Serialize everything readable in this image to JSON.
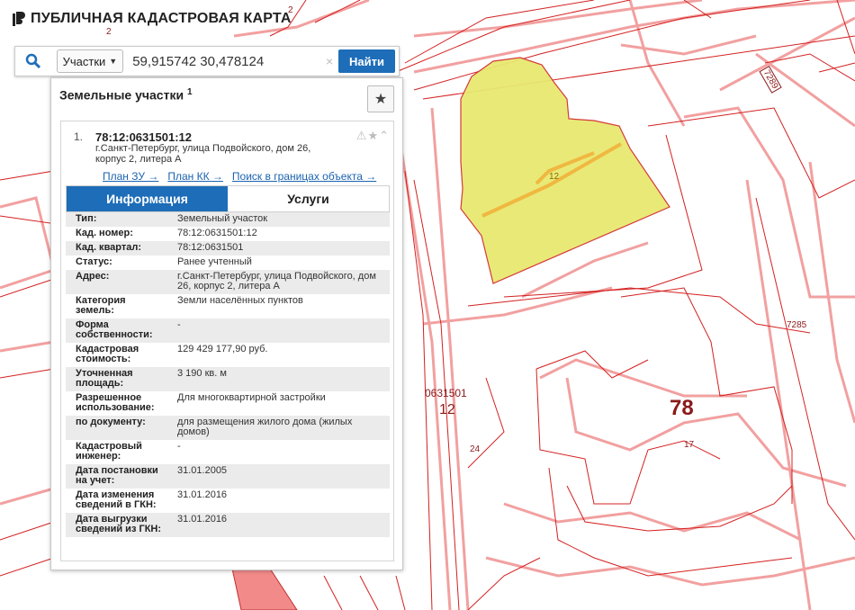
{
  "app": {
    "title": "ПУБЛИЧНАЯ КАДАСТРОВАЯ КАРТА"
  },
  "search": {
    "type_label": "Участки",
    "query": "59,915742 30,478124",
    "clear": "×",
    "find_label": "Найти"
  },
  "panel": {
    "title": "Земельные участки",
    "count": "1",
    "record": {
      "number": "1.",
      "cad_number": "78:12:0631501:12",
      "address": "г.Санкт-Петербург, улица Подвойского, дом 26, корпус 2, литера А",
      "status_icons": "⚠★⌃",
      "links": [
        "План ЗУ →",
        "План КК →",
        "Поиск в границах объекта →"
      ]
    },
    "tabs": [
      "Информация",
      "Услуги"
    ],
    "rows": [
      {
        "k": "Тип:",
        "v": "Земельный участок"
      },
      {
        "k": "Кад. номер:",
        "v": "78:12:0631501:12"
      },
      {
        "k": "Кад. квартал:",
        "v": "78:12:0631501"
      },
      {
        "k": "Статус:",
        "v": "Ранее учтенный"
      },
      {
        "k": "Адрес:",
        "v": "г.Санкт-Петербург, улица Подвойского, дом 26, корпус 2, литера А"
      },
      {
        "k": "Категория земель:",
        "v": "Земли населённых пунктов"
      },
      {
        "k": "Форма собственности:",
        "v": "-"
      },
      {
        "k": "Кадастровая стоимость:",
        "v": "129 429 177,90 руб."
      },
      {
        "k": "Уточненная площадь:",
        "v": "3 190 кв. м"
      },
      {
        "k": "Разрешенное использование:",
        "v": "Для многоквартирной застройки"
      },
      {
        "k": "по документу:",
        "v": "для размещения жилого дома (жилых домов)"
      },
      {
        "k": "Кадастровый инженер:",
        "v": "-"
      },
      {
        "k": "Дата постановки на учет:",
        "v": "31.01.2005"
      },
      {
        "k": "Дата изменения сведений в ГКН:",
        "v": "31.01.2016"
      },
      {
        "k": "Дата выгрузки сведений из ГКН:",
        "v": "31.01.2016"
      }
    ]
  },
  "map_labels": {
    "top_2a": "2",
    "top_2b": "2",
    "plot_12": "12",
    "block_code": "0631501",
    "block_12": "12",
    "region_78": "78",
    "n24": "24",
    "n17": "17",
    "n7285": "7285",
    "n7289": "7289"
  },
  "colors": {
    "accent": "#1e6db8",
    "parcel_fill": "#e8e870",
    "boundary": "#e02020",
    "road": "#f2a0a0"
  }
}
